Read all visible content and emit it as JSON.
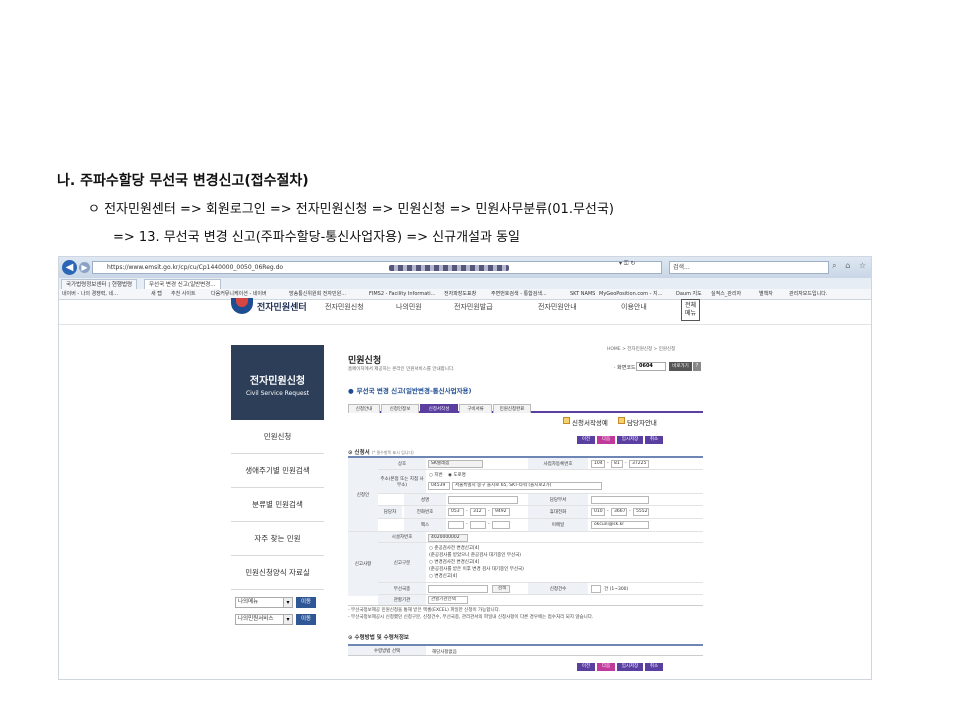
{
  "slide": {
    "heading": "나. 주파수할당 무선국 변경신고(접수절차)",
    "step1": "ㅇ 전자민원센터 => 회원로그인 => 전자민원신청 => 민원신청 => 민원사무분류(01.무선국)",
    "step2": "=> 13. 무선국 변경 신고(주파수할당-통신사업자용) => 신규개설과 동일"
  },
  "browser": {
    "url": "https://www.emsit.go.kr/cp/cu/Cp1440000_0050_06Reg.do",
    "search_placeholder": "검색...",
    "tabs": [
      "국가법령정보센터 | 현행법령",
      "무선국 변경 신고(일반변경..."
    ],
    "favorites": [
      "네이버 - 나의 경쟁력, 네...",
      "새 탭",
      "추천 사이트",
      "다음커뮤니케이션 - 네이버",
      "방송통신위원회 전자민원...",
      "FIMS2 - Facility Informati...",
      "전자파장도표창",
      "주변번호검색 - 통합검색...",
      "SKT NAMS",
      "MyGeoPosition.com - 지...",
      "Daum 지도",
      "실적스_관리자",
      "별책자",
      "관리자모드입니다."
    ]
  },
  "site": {
    "logo": "전자민원센터",
    "nav": [
      "전자민원신청",
      "나의민원",
      "전자민원발급",
      "전자민원안내",
      "이용안내"
    ],
    "all_menu": "전체 메뉴"
  },
  "left_panel": {
    "title": "전자민원신청",
    "subtitle": "Civil Service Request",
    "items": [
      "민원신청",
      "생애주기별 민원검색",
      "분류별 민원검색",
      "자주 찾는 민원",
      "민원신청양식 자료실"
    ],
    "select1": "나의메뉴",
    "select2": "나의민원서비스",
    "go": "이동"
  },
  "content": {
    "title": "민원신청",
    "subtitle": "홈페이지에서 제공하는 온라인 민원서비스를 안내합니다.",
    "breadcrumb": "HOME > 전자민원신청 > 민원신청",
    "screen_label": "· 화면코드",
    "screen_code": "0604",
    "shortcut": "바로가기",
    "help": "?",
    "section_title": "무선국 변경 신고(일반변경-통신사업자용)",
    "steps": [
      "신청안내",
      "신청인정보",
      "신청서작성",
      "구비서류",
      "민원신청완료"
    ],
    "guide1": "신청서작성예",
    "guide2": "담당자안내",
    "action_buttons": [
      "이전",
      "다음",
      "임시저장",
      "취소"
    ]
  },
  "form": {
    "applicant_header": "신청서",
    "required_note": "(* 필수항목 표시 입니다)",
    "applicant_label": "신청인",
    "company_label": "상호",
    "company_value": "SK텔레콤",
    "bizno_label": "사업자등록번호",
    "bizno": [
      "104",
      "81",
      "37225"
    ],
    "address_label": "주소(본점 또는 지점 사무소)",
    "address_opts": [
      "지번",
      "도로명"
    ],
    "zip": "04539",
    "address": "서울특별시 중구 을지로 65, SKT-타워 (을지로2가)",
    "name_label": "성명",
    "dept_label": "담당부서",
    "contact_label": "담당자",
    "phone_label": "전화번호",
    "phone": [
      "053",
      "312",
      "9492"
    ],
    "mobile_label": "휴대전화",
    "mobile": [
      "010",
      "3667",
      "5552"
    ],
    "fax_label": "팩스",
    "email_label": "이메일",
    "email": "okcuni@sk.kr",
    "report_label": "신고사항",
    "facility_label": "시설자번호",
    "facility": "4020000002",
    "type_label": "신고구분",
    "type_options": [
      "준공검사전 변경신고[4]",
      "(준공검사를 받았으나 준공검사 대기중인 무선국)",
      "변경검사전 변경신고[4]",
      "(준공검사를 받은 이후 변경 검사 대기중인 무선국)",
      "변경신고[4]"
    ],
    "station_label": "무선국종",
    "station_btn": "검색",
    "count_label": "신청건수",
    "count_value": "건 (1~300)",
    "agency_label": "관할기관",
    "agency_value": "관할기관선택",
    "notes": [
      "- 무선국정보제공 민원신청을 통해 받은 엑셀(EXCEL) 파일만 신청이 가능합니다.",
      "- 무선국정보제공시 신청했던 신청구분, 신청건수, 무선국종, 관리관서의 파일내 신청사항이 다른 경우에는 접수처리 되지 않습니다."
    ],
    "receipt_header": "수령방법 및 수령처정보",
    "receipt_label": "수령방법 선택",
    "receipt_value": "해당사항없음"
  },
  "colors": {
    "accent": "#5a3fa0",
    "brand": "#1f4d92",
    "panel": "#2c3e58"
  }
}
